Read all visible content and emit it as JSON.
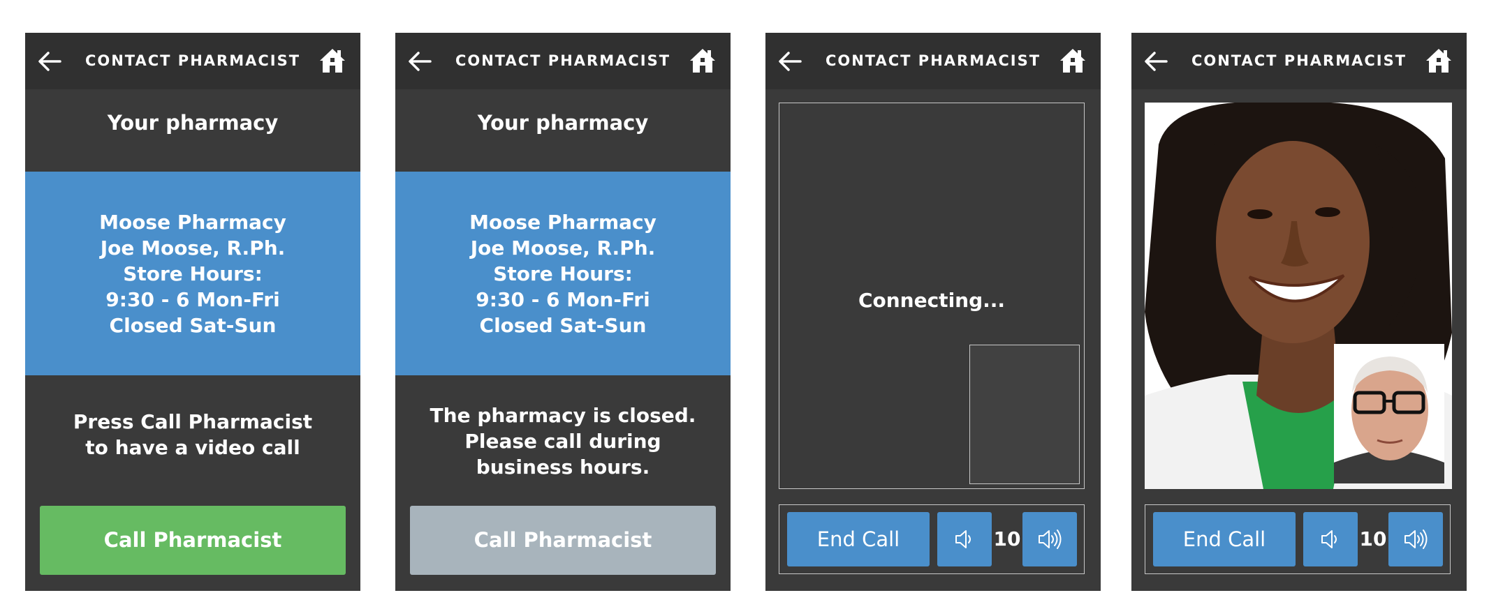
{
  "header": {
    "title": "CONTACT PHARMACIST"
  },
  "pharmacy": {
    "label": "Your pharmacy",
    "lines": [
      "Moose Pharmacy",
      "Joe Moose, R.Ph.",
      "Store Hours:",
      "9:30 - 6 Mon-Fri",
      "Closed Sat-Sun"
    ]
  },
  "screen1": {
    "message_lines": [
      "Press Call Pharmacist",
      "to have a video call"
    ],
    "button": "Call Pharmacist"
  },
  "screen2": {
    "message_lines": [
      "The pharmacy is closed.",
      "Please call during",
      "business hours."
    ],
    "button": "Call Pharmacist"
  },
  "call": {
    "status": "Connecting...",
    "end_label": "End Call",
    "volume": "10"
  },
  "colors": {
    "accent_blue": "#4a8fcb",
    "call_green": "#66bb62",
    "disabled_grey": "#a8b4bc",
    "background": "#3a3a3a",
    "topbar": "#303030"
  }
}
